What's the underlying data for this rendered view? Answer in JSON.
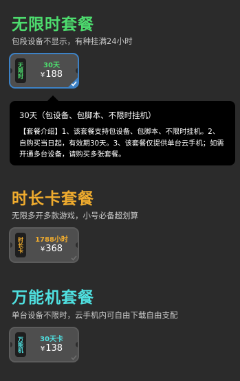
{
  "sections": [
    {
      "title": "无限时套餐",
      "title_color": "#4ddc6e",
      "subtitle": "包段设备不显示，有种挂满24小时",
      "card": {
        "tag": "无限时",
        "name": "30天",
        "name_color": "#4ddc6e",
        "currency": "¥",
        "price": "188",
        "selected": true
      }
    },
    {
      "title": "时长卡套餐",
      "title_color": "#f0ac2e",
      "subtitle": "无限多开多款游戏，小号必备超划算",
      "card": {
        "tag": "时长卡",
        "name": "1788小时",
        "name_color": "#f0ac2e",
        "currency": "¥",
        "price": "368",
        "selected": false
      }
    },
    {
      "title": "万能机套餐",
      "title_color": "#4fe0e0",
      "subtitle": "单台设备不限时，云手机内可自由下载自由支配",
      "card": {
        "tag": "万能机",
        "name": "30天卡",
        "name_color": "#4fe0e0",
        "currency": "¥",
        "price": "138",
        "selected": false
      }
    }
  ],
  "tooltip": {
    "title": "30天（包设备、包脚本、不限时挂机）",
    "body": "【套餐介绍】1、该套餐支持包设备、包脚本、不限时挂机。2、自购买当日起，有效期30天。3、该套餐仅提供单台云手机；如需开通多台设备，请购买多张套餐。"
  },
  "icons": {
    "check": "checkmark-corner-icon"
  },
  "colors": {
    "background": "#2b2b2b",
    "selected_border": "#3d82c6"
  }
}
